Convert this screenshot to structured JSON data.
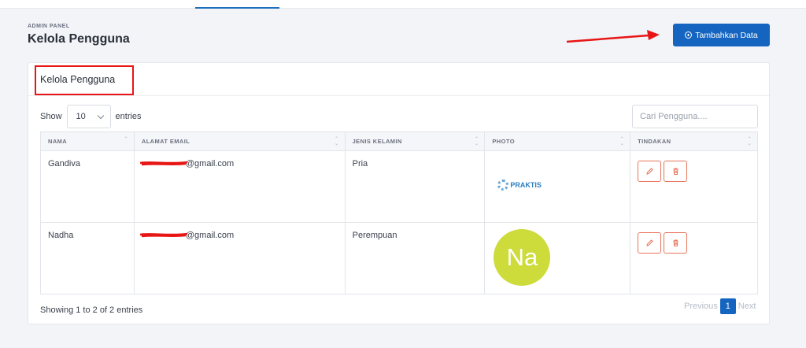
{
  "header": {
    "breadcrumb": "ADMIN PANEL",
    "title": "Kelola Pengguna",
    "add_button_label": "Tambahkan Data"
  },
  "card": {
    "title": "Kelola Pengguna",
    "show_label": "Show",
    "entries_label": "entries",
    "page_size": "10",
    "search_placeholder": "Cari Pengguna...."
  },
  "table": {
    "columns": [
      "NAMA",
      "ALAMAT EMAIL",
      "JENIS KELAMIN",
      "PHOTO",
      "TINDAKAN"
    ],
    "rows": [
      {
        "name": "Gandiva",
        "email": "@gmail.com",
        "gender": "Pria",
        "photo": "PRAKTIS"
      },
      {
        "name": "Nadha",
        "email": "@gmail.com",
        "gender": "Perempuan",
        "photo": "Na"
      }
    ]
  },
  "footer": {
    "info": "Showing 1 to 2 of 2 entries",
    "previous": "Previous",
    "current_page": "1",
    "next": "Next"
  },
  "colors": {
    "primary": "#1565c0",
    "danger_outline": "#e8745a",
    "annotation_red": "#e81515",
    "avatar_bg": "#cddb3b"
  },
  "icons": {
    "add": "plus-circle-icon",
    "edit": "pencil-icon",
    "delete": "trash-icon",
    "sort": "sort-icon",
    "dropdown": "chevron-down-icon"
  }
}
